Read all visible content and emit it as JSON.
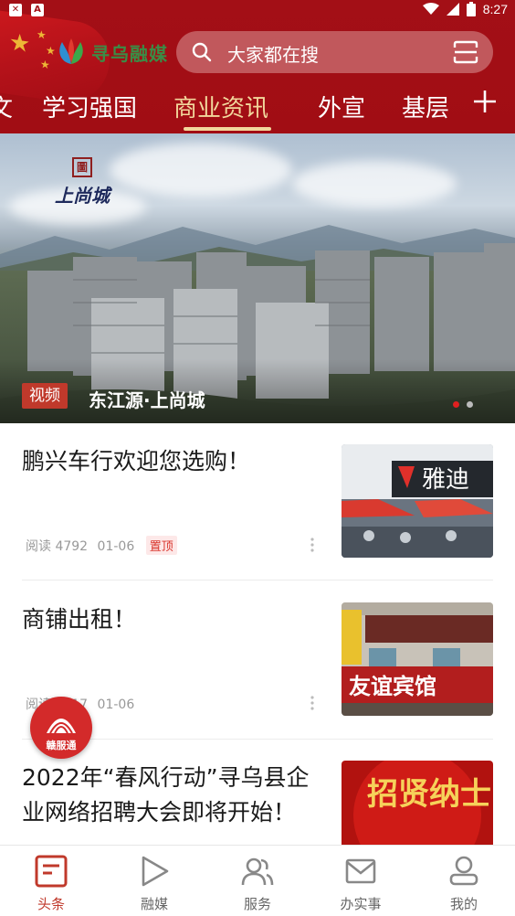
{
  "status_bar": {
    "time": "8:27"
  },
  "header": {
    "logo_text": "寻乌融媒",
    "search_placeholder": "大家都在搜"
  },
  "tabs": {
    "items": [
      "文",
      "学习强国",
      "商业资讯",
      "外宣",
      "基层"
    ],
    "active": "商业资讯"
  },
  "banner": {
    "logo_text": "上尚城",
    "badge": "视频",
    "title": "东江源·上尚城",
    "slide_count": 2,
    "active_slide": 1
  },
  "news": [
    {
      "title": "鹏兴车行欢迎您选购！",
      "reads_label": "阅读 4792",
      "date": "01-06",
      "badge": "置顶",
      "thumb_text": "雅迪"
    },
    {
      "title": "商铺出租！",
      "reads_label": "阅读 4717",
      "date": "01-06",
      "thumb_text": "友谊宾馆"
    },
    {
      "title": "2022年“春风行动”寻乌县企业网络招聘大会即将开始！",
      "thumb_text": "招贤纳士"
    }
  ],
  "fab": {
    "label": "赣服通"
  },
  "bottom_nav": [
    {
      "label": "头条",
      "icon": "headline-icon",
      "active": true
    },
    {
      "label": "融媒",
      "icon": "play-icon",
      "active": false
    },
    {
      "label": "服务",
      "icon": "users-icon",
      "active": false
    },
    {
      "label": "办实事",
      "icon": "mail-icon",
      "active": false
    },
    {
      "label": "我的",
      "icon": "profile-icon",
      "active": false
    }
  ],
  "colors": {
    "header_red": "#a30f16",
    "tab_active": "#f2d79c",
    "accent_red": "#c0392b"
  }
}
